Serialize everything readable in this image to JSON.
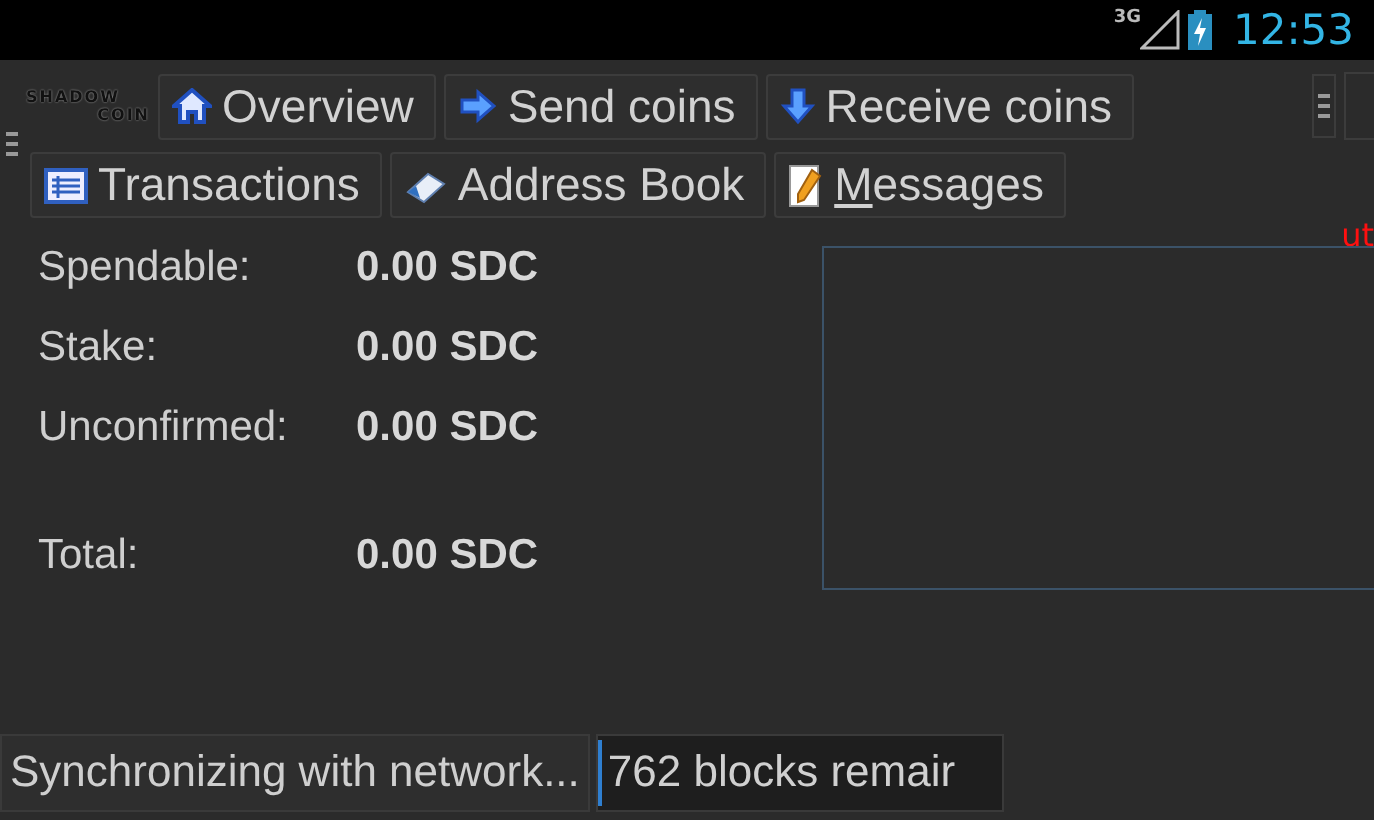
{
  "status_bar": {
    "network": "3G",
    "time": "12:53"
  },
  "logo": {
    "line1": "SHADOW",
    "line2": "COIN"
  },
  "toolbar": [
    {
      "label": "Overview",
      "shortcut_underlined": false
    },
    {
      "label": "Send coins",
      "shortcut_underlined": false
    },
    {
      "label": "Receive coins",
      "shortcut_underlined": false
    },
    {
      "label": "Transactions",
      "shortcut_underlined": false
    },
    {
      "label": "Address Book",
      "shortcut_underlined": false
    },
    {
      "label": "Messages",
      "shortcut_underlined": true
    }
  ],
  "balances": [
    {
      "label": "Spendable:",
      "value": "0.00 SDC"
    },
    {
      "label": "Stake:",
      "value": "0.00 SDC"
    },
    {
      "label": "Unconfirmed:",
      "value": "0.00 SDC"
    },
    {
      "label": "Total:",
      "value": "0.00 SDC",
      "kind": "total"
    }
  ],
  "recent_heading": "ut",
  "footer": {
    "status": "Synchronizing with network...",
    "progress_text": "762 blocks remair",
    "level": 0.01
  }
}
